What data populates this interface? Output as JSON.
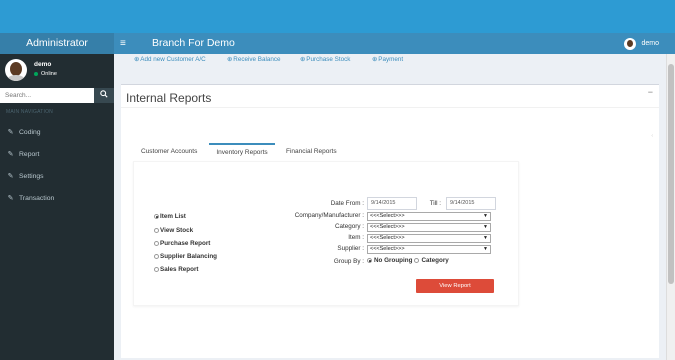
{
  "header": {
    "brand": "Administrator",
    "menu_icon": "hamburger-icon",
    "branch": "Branch For Demo",
    "user": "demo"
  },
  "sidebar": {
    "user_name": "demo",
    "user_status": "Online",
    "search_placeholder": "Search...",
    "nav_header": "MAIN NAVIGATION",
    "items": [
      {
        "label": "Coding",
        "icon": "edit-icon"
      },
      {
        "label": "Report",
        "icon": "edit-icon"
      },
      {
        "label": "Settings",
        "icon": "edit-icon"
      },
      {
        "label": "Transaction",
        "icon": "edit-icon"
      }
    ]
  },
  "quicklinks": [
    {
      "label": "Add new Customer A/C"
    },
    {
      "label": "Receive Balance"
    },
    {
      "label": "Purchase Stock"
    },
    {
      "label": "Payment"
    }
  ],
  "page": {
    "title": "Internal Reports",
    "collapse_symbol": "−",
    "tabs": [
      {
        "label": "Customer Accounts"
      },
      {
        "label": "Inventory Reports"
      },
      {
        "label": "Financial Reports"
      }
    ],
    "active_tab": "Inventory Reports"
  },
  "report_types": [
    {
      "label": "Item List",
      "checked": true
    },
    {
      "label": "View Stock",
      "checked": false
    },
    {
      "label": "Purchase Report",
      "checked": false
    },
    {
      "label": "Supplier Balancing",
      "checked": false
    },
    {
      "label": "Sales Report",
      "checked": false
    }
  ],
  "filters": {
    "date_from_label": "Date From :",
    "date_from_value": "9/14/2015",
    "till_label": "Till :",
    "till_value": "9/14/2015",
    "company_label": "Company/Manufacturer :",
    "company_value": "<<<Select>>>",
    "category_label": "Category :",
    "category_value": "<<<Select>>>",
    "item_label": "Item :",
    "item_value": "<<<Select>>>",
    "supplier_label": "Supplier :",
    "supplier_value": "<<<Select>>>",
    "group_by_label": "Group By :",
    "group_no_grouping": "No Grouping",
    "group_category": "Category",
    "group_selected": "No Grouping"
  },
  "buttons": {
    "view_report": "View Report"
  },
  "colors": {
    "header_blue": "#3c8dbc",
    "brand_blue": "#367fa9",
    "sidebar_dark": "#222d32",
    "button_red": "#dd4b39"
  }
}
